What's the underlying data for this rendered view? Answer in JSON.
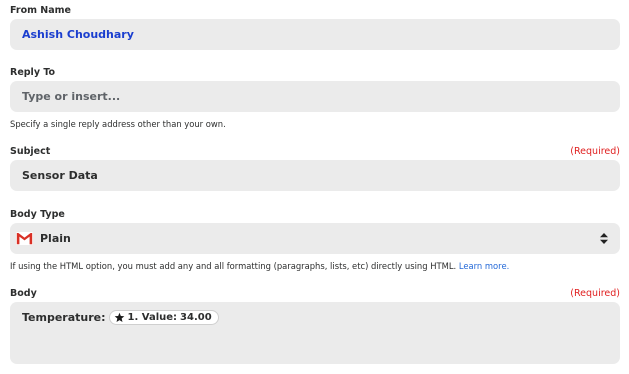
{
  "from_name": {
    "label": "From Name",
    "value": "Ashish Choudhary"
  },
  "reply_to": {
    "label": "Reply To",
    "placeholder": "Type or insert...",
    "help": "Specify a single reply address other than your own."
  },
  "subject": {
    "label": "Subject",
    "required": "(Required)",
    "value": "Sensor Data"
  },
  "body_type": {
    "label": "Body Type",
    "value": "Plain",
    "icon": "gmail-icon",
    "help": "If using the HTML option, you must add any and all formatting (paragraphs, lists, etc) directly using HTML.",
    "link": "Learn more."
  },
  "body": {
    "label": "Body",
    "required": "(Required)",
    "text": "Temperature:",
    "pill": {
      "icon": "star-icon",
      "label": "1. Value:",
      "value": "34.00"
    }
  },
  "colors": {
    "link": "#2469d8",
    "required": "#e02020",
    "field_bg": "#ebebeb",
    "value_blue": "#1a3ecf"
  }
}
